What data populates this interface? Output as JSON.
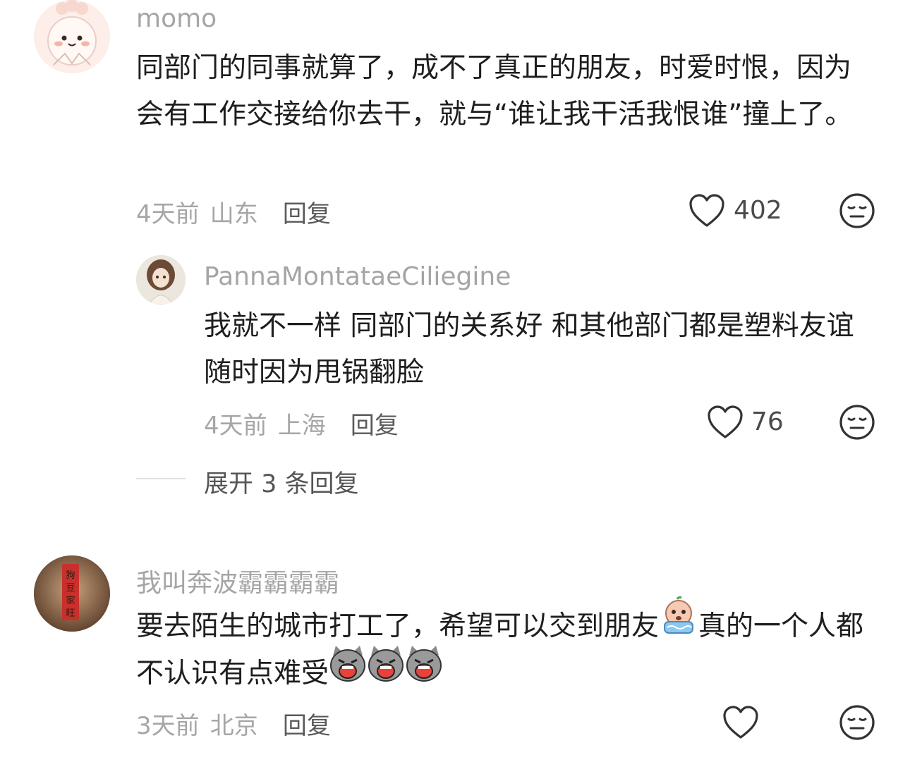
{
  "comments": [
    {
      "username": "momo",
      "text": "同部门的同事就算了，成不了真正的朋友，时爱时恨，因为会有工作交接给你去干，就与“谁让我干活我恨谁”撞上了。",
      "time": "4天前",
      "location": "山东",
      "reply_label": "回复",
      "likes": "402",
      "avatar_icon": "cartoon-girl-avatar",
      "reply": {
        "username": "PannaMontataeCiliegine",
        "text": "我就不一样 同部门的关系好 和其他部门都是塑料友谊 随时因为甩锅翻脸",
        "time": "4天前",
        "location": "上海",
        "reply_label": "回复",
        "likes": "76",
        "avatar_icon": "doll-avatar"
      },
      "expand_label": "展开 3 条回复"
    },
    {
      "username": "我叫奔波霸霸霸霸",
      "text_part1": "要去陌生的城市打工了，希望可以交到朋友",
      "text_part2": "真的一个人都不认识有点难受",
      "time": "3天前",
      "location": "北京",
      "reply_label": "回复",
      "likes": "",
      "avatar_icon": "red-banner-avatar",
      "avatar_text": "狗豆家旺",
      "inline_emojis": [
        "crying-baby-emoji",
        "crying-cat-emoji",
        "crying-cat-emoji",
        "crying-cat-emoji"
      ]
    }
  ],
  "colors": {
    "username": "#a5a5a5",
    "text": "#1e1e1e",
    "meta": "#a6a6a6"
  }
}
